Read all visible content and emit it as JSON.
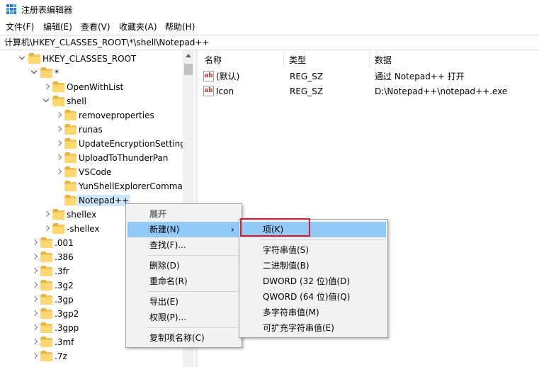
{
  "window": {
    "title": "注册表编辑器"
  },
  "menubar": [
    "文件(F)",
    "编辑(E)",
    "查看(V)",
    "收藏夹(A)",
    "帮助(H)"
  ],
  "address": "计算机\\HKEY_CLASSES_ROOT\\*\\shell\\Notepad++",
  "tree": [
    {
      "label": "HKEY_CLASSES_ROOT",
      "level": 0,
      "toggle": "open"
    },
    {
      "label": "*",
      "level": 1,
      "toggle": "open"
    },
    {
      "label": "OpenWithList",
      "level": 2,
      "toggle": "closed"
    },
    {
      "label": "shell",
      "level": 2,
      "toggle": "open"
    },
    {
      "label": "removeproperties",
      "level": 3,
      "toggle": "closed"
    },
    {
      "label": "runas",
      "level": 3,
      "toggle": "closed"
    },
    {
      "label": "UpdateEncryptionSettings",
      "level": 3,
      "toggle": "closed"
    },
    {
      "label": "UploadToThunderPan",
      "level": 3,
      "toggle": "closed"
    },
    {
      "label": "VSCode",
      "level": 3,
      "toggle": "closed"
    },
    {
      "label": "YunShellExplorerCommand",
      "level": 3,
      "toggle": "none"
    },
    {
      "label": "Notepad++",
      "level": 3,
      "toggle": "none",
      "selected": true
    },
    {
      "label": "shellex",
      "level": 2,
      "toggle": "closed"
    },
    {
      "label": "-shellex",
      "level": 2,
      "toggle": "closed"
    },
    {
      "label": ".001",
      "level": 1,
      "toggle": "closed"
    },
    {
      "label": ".386",
      "level": 1,
      "toggle": "closed"
    },
    {
      "label": ".3fr",
      "level": 1,
      "toggle": "closed"
    },
    {
      "label": ".3g2",
      "level": 1,
      "toggle": "closed"
    },
    {
      "label": ".3gp",
      "level": 1,
      "toggle": "closed"
    },
    {
      "label": ".3gp2",
      "level": 1,
      "toggle": "closed"
    },
    {
      "label": ".3gpp",
      "level": 1,
      "toggle": "closed"
    },
    {
      "label": ".3mf",
      "level": 1,
      "toggle": "closed"
    },
    {
      "label": ".7z",
      "level": 1,
      "toggle": "closed"
    }
  ],
  "list": {
    "columns": [
      "名称",
      "类型",
      "数据"
    ],
    "rows": [
      {
        "icon": "ab",
        "name": "(默认)",
        "type": "REG_SZ",
        "data": "通过 Notepad++ 打开"
      },
      {
        "icon": "ab",
        "name": "Icon",
        "type": "REG_SZ",
        "data": "D:\\Notepad++\\notepad++.exe"
      }
    ]
  },
  "context_menu": {
    "items": [
      {
        "label": "展开",
        "header": true
      },
      {
        "label": "新建(N)",
        "submenu": true,
        "highlighted": true
      },
      {
        "label": "查找(F)..."
      },
      {
        "sep": true
      },
      {
        "label": "删除(D)"
      },
      {
        "label": "重命名(R)"
      },
      {
        "sep": true
      },
      {
        "label": "导出(E)"
      },
      {
        "label": "权限(P)..."
      },
      {
        "sep": true
      },
      {
        "label": "复制项名称(C)"
      }
    ]
  },
  "submenu": {
    "items": [
      {
        "label": "项(K)",
        "highlighted": true
      },
      {
        "sep": true
      },
      {
        "label": "字符串值(S)"
      },
      {
        "label": "二进制值(B)"
      },
      {
        "label": "DWORD (32 位)值(D)"
      },
      {
        "label": "QWORD (64 位)值(Q)"
      },
      {
        "label": "多字符串值(M)"
      },
      {
        "label": "可扩充字符串值(E)"
      }
    ]
  },
  "colors": {
    "highlight": "#91c9f7",
    "selection": "#cce8ff",
    "annotation": "#e0162b",
    "folder": "#ffd86e"
  }
}
